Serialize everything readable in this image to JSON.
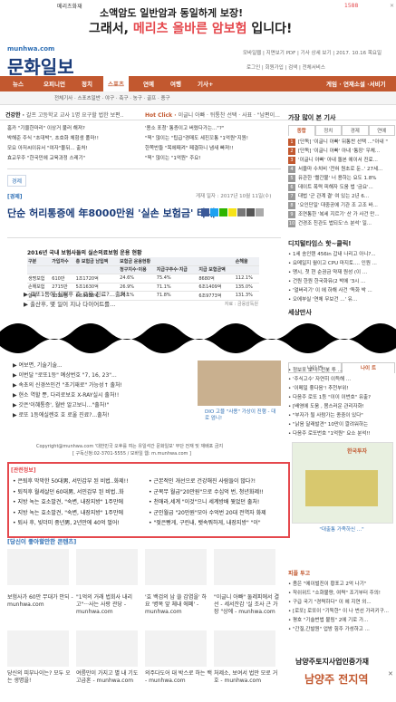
{
  "ad_banner": {
    "brand": "메리츠화재",
    "line1": "소액암도 일반암과 동일하게 보장!",
    "line2_prefix": "그래서, ",
    "line2_highlight": "메리츠 올바른 암보험",
    "line2_suffix": " 입니다!",
    "phone": "1588"
  },
  "header": {
    "site_url": "munhwa.com",
    "logo": "문화일보",
    "util_links": "모바일웹 | 지면보기 PDF | 기사 상세 보기 | 2017. 10.16 목요일",
    "util_links2": "로그인 | 회원가입 | 검색 | 전체서비스"
  },
  "nav": {
    "items": [
      "뉴스",
      "오피니언",
      "정치",
      "경제",
      "스포츠",
      "연예",
      "여행",
      "기사+"
    ],
    "active_index": 4,
    "right": "게임 · 연재소설 ·서비기"
  },
  "subnav": "전체기사 · 스포츠일반 · 야구 · 축구 · 농구 · 골프 · 종구",
  "ticker": {
    "label": "건강한",
    "text": "갈프 고등학교 교사 1명 요구할 법한 보편..",
    "hot_label": "Hot Click",
    "hot_text": "이글니 아빠 · 뒤통찬 선택 · 사표 · \"남편이..."
  },
  "top_links_left": [
    "홈카 \"기울한마리\" 이상거 불러 해져?",
    "박해준 주식 \"초대박\", 초호화 체험생 폴마!!",
    "모요 아저씨이유서 \"여자\"몰뒤... 출처!",
    "효교우주 \"한국민에 교육과정 스레기\""
  ],
  "top_links_right": [
    "'용소 포청' 통증이고 버렸다가는...\"?\"",
    "\"찍\" 많이는 \"팁급\"경매도 세진꼬통 \"1억원\"지원!",
    "한쪽반들 \"목에때켜\" 페결하니 냄새 빠져!!",
    "\"찍\" 많이는 \"1억원\" 주요!"
  ],
  "article": {
    "section_tab": "경제",
    "category": "[경제]",
    "date": "게재 일자 : 2017년 10월 11일(수)",
    "headline": "단순 허리통증에 年8000만원 '실손 보험금' 타내",
    "table_title": "2016년 국내 보험사들의 실손의료보험 운용 현황",
    "table_headers": [
      "구분",
      "가입자수",
      "총 보험금 남입액",
      "보험금 운용현황",
      "",
      "",
      "",
      "손해율"
    ],
    "table_sub_headers": [
      "",
      "",
      "",
      "청구지수·이용",
      "지급구주수·지급",
      "지급 보험금액",
      ""
    ],
    "table_rows": [
      [
        "생명보험",
        "610만",
        "1조1720억",
        "24.6%",
        "75.4%",
        "8680억",
        "112.1%"
      ],
      [
        "손해보험",
        "2715만",
        "5조1630억",
        "26.9%",
        "71.1%",
        "6조1409억",
        "135.0%"
      ],
      [
        "합계",
        "3331만",
        "6조3358억",
        "26.1%",
        "71.8%",
        "6조9773억",
        "131.3%"
      ]
    ],
    "table_source": "자료 : 금융감독원"
  },
  "related_below": [
    "로또1등에 실패후 호 로울 진료?...출처!",
    "출산후, 몇 일이 지나 다이어트를..."
  ],
  "ad_mid_caption": "DIO 고블 \"사용\" 가상이 진행 - 대로 엄니!",
  "more_links": [
    "여보면, 기술기술...",
    "이번달 \"로또1등\" 예상번호 \"7, 16, 23\"...",
    "속초의 신경쓰인건 \"초기재로\" 가능성↑ 출처!",
    "현소 역할 뿐, 다리로보호 X-RAY실시 출처!!",
    "갓은'이혜통증', 월반 알고보니...\"출처!\"",
    "로또 1등에실렌호 호 로울 진료?...출처!"
  ],
  "footer": {
    "copyright": "Copyright@munhwa.com '대한민국 오후를 여는 유일석간 문화일보' 무단 전재 및 재배포 금지",
    "contact": "[ 구독신청:02-3701-5555 / 모바일 웹: m.munhwa.com ]"
  },
  "related_box": {
    "title": "[관련정보]",
    "left": [
      "은퇴후 막막한 50대男, 서민갑부 된 비법..화제!!",
      "퇴직후 월세살던 60대男, 서민갑부 된 비법..화",
      "지방 녹는 효소발견, \"숙변, 내장지방\" 1주만에",
      "지방 녹는 효소발견, \"숙변, 내장지방\" 1주만에",
      "퇴사 후, 빚더미 중년男, 2년만에 40억 벌어!"
    ],
    "right": [
      "근본적인 개선으로 건강해진 사람들이 많다?!",
      "군복무 월급\"20만원\"으로 수십억 번, 청년화제!!",
      "천애라,세계 \"이것\"으니 세계방배 뭣었던 출처!",
      "군인월급 \"20만원\"모아 수억번 20대 전역자 화제",
      "\"젖은빵게, 구린내, 뱃속뭐하게, 내장지방\" \"이\""
    ]
  },
  "recommend": {
    "title": "[당신이 좋아할만한 콘텐츠]",
    "row1": [
      "보험사가 60만 무대가 안되 - munhwa.com",
      "\"1억의 거래 법회사 내리 고\"···사는 사랑 관당 - munhwa.com",
      "'효 백검의 남 쓸 감염을' 하 요 '병목 앞 체내 에폐' - munhwa.com",
      "\"이글니 아빠\" 둘레피에서 결 선 - 세서잔감 '실 조사 근 가장 \"상에 - munhwa.com"
    ],
    "row2": [
      "당신의 피부나이는? 모두 오는 생명을!",
      "여름만이 가지고 별 내 기도 고급혼 - munhwa.com",
      "의주다도어 대 박스로 하는 백 - munhwa.com",
      "처제소, 보여서 법만 모로 거 호 - munhwa.com"
    ]
  },
  "sidebar": {
    "most_viewed_title": "가장 많이 본 기사",
    "tabs": [
      "종합",
      "정치",
      "경제",
      "연예"
    ],
    "active_tab": 0,
    "most_viewed": [
      "[단독] '이글니 아빠' 뒤통찬 선택 ...\"아내 \"",
      "[단독] '이글니 아빠' 아내 '통장' 우체...",
      "'이글니 아빠' 아내 돌본 에이서 진료...",
      "서울마 수치비 '전혀 원초로 둔..' 27세...",
      "유관한 '빨간불' 너 용하는 요도 1.8%",
      "데이트 폭력 피해자 도움 법 '금요'...",
      "대법 '군 관계 결' 여 있는 2년 6...",
      "'오인단일' 대중공에 기관 조 고조 바...",
      "조연통한 '복세 지르기' 산 가 사건 만...",
      "건경조 친관도 법되도'스 분석' 일...",
      "정장원 박 문대인 '정 일여기' 여대 수..."
    ],
    "digital_title": "디지털타임스 핫~클릭!",
    "digital_list": [
      "1세 송인텐 456in 갑내 나리고 아니?...",
      "요메일지 월이고 CPU 마지토.... 인원 ...",
      "맹시, 첫 현 순권금 약재 원성 (이 ...",
      "건원 한원 한국화뮤(2 박에 '3시 ...",
      "'얼버리기' 이 에 하해 사건 '독화 박 ...",
      "오에부실 '연체 무보건 ...' 유...",
      "'최기이미' 이 반에 만 '체험지 C755대'..."
    ],
    "trend_title": "세상만사",
    "trend_tabs": [
      "나이 번",
      "나이 트"
    ],
    "trend_list": [
      "중요마이 나이...",
      "위도 나이 차니...",
      "정보포 보니! 전봇 투 ...",
      "'주식고수' 자연히 이득해 ...",
      "'이메일 좋다음'! 추천부위!",
      "다음주 로또 1등 \"이이 이번호\" 유출?",
      "[배영에 도움 , 몸스러운 관리자화!",
      "\"부자가 될 사람가는 종중이 있다\"",
      "\"낡음 달래발견\" 10만이 깔려워하는",
      "다음주 로또번호 \"1억원\" 요소 분석!!",
      "\"격수가보니 흡수수용들이\" 이 거나 ...",
      "\"좋은 혈액을 만드는 목입 호르몬은 나요!!",
      "\"종뉴당\" 무사하게 알려보는 방법\""
    ],
    "ad_company": "한국투자",
    "ad_caption": "\"대출통 가족하신 ...\"",
    "popular_title": "피플 투고",
    "popular_list": [
      "좀은 \"에이벌진이 황포고 2억 나기\"",
      "작쉬위드 \"소화불량, 여력\" 조기부터 주의!",
      "구급 국기 \"경력하다\" 이 에 지연 외...",
      "[로또] 로또이 \"기둑한\" 이 나 번선 가리키구...",
      "평호 \"기술번법 불림\" 2에 기로 가...",
      "\"간질,간발원\" 업방 힘주 가성하고 ..."
    ],
    "bottom_ad_line1": "남양주토지사업인증가재",
    "bottom_ad_line2": "남양주 전지역"
  }
}
